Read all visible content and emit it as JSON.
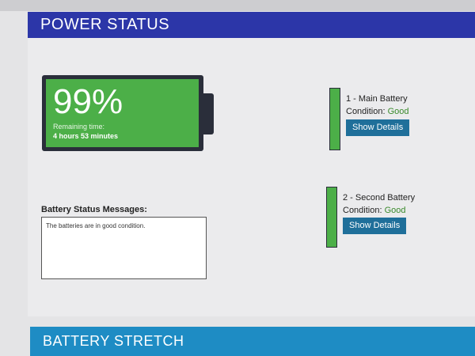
{
  "sections": {
    "power_status_title": "POWER STATUS",
    "battery_stretch_title": "BATTERY STRETCH"
  },
  "battery_summary": {
    "percent_text": "99%",
    "percent_value": 99,
    "remaining_label": "Remaining time:",
    "remaining_value": "4 hours 53 minutes"
  },
  "batteries": [
    {
      "title": "1 - Main Battery",
      "condition_label": "Condition: ",
      "condition_value": "Good",
      "details_button": "Show Details"
    },
    {
      "title": "2 - Second Battery",
      "condition_label": "Condition: ",
      "condition_value": "Good",
      "details_button": "Show Details"
    }
  ],
  "messages": {
    "label": "Battery Status Messages:",
    "text": "The batteries are in good condition."
  },
  "colors": {
    "power_header": "#2c36a8",
    "stretch_header": "#1e8cc4",
    "battery_green": "#4caf48",
    "button_blue": "#1f6f9a",
    "good_text": "#3a8a2c"
  }
}
